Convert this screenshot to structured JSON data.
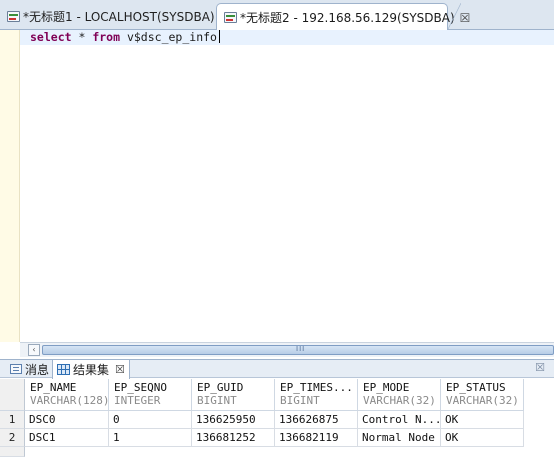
{
  "editor_tabs": [
    {
      "label": "*无标题1 - LOCALHOST(SYSDBA)",
      "active": false
    },
    {
      "label": "*无标题2 - 192.168.56.129(SYSDBA)",
      "active": true,
      "close": "☒"
    }
  ],
  "editor": {
    "kw_select": "select",
    "star": " * ",
    "kw_from": "from",
    "table": " v$dsc_ep_info"
  },
  "scrollbar": {
    "left_arrow": "‹",
    "grip": "III"
  },
  "result_tabs": {
    "messages_label": "消息",
    "results_label": "结果集",
    "close": "☒",
    "maximize": "☒"
  },
  "grid": {
    "columns": [
      {
        "name": "EP_NAME",
        "type": "VARCHAR(128)"
      },
      {
        "name": "EP_SEQNO",
        "type": "INTEGER"
      },
      {
        "name": "EP_GUID",
        "type": "BIGINT"
      },
      {
        "name": "EP_TIMES...",
        "type": "BIGINT"
      },
      {
        "name": "EP_MODE",
        "type": "VARCHAR(32)"
      },
      {
        "name": "EP_STATUS",
        "type": "VARCHAR(32)"
      }
    ],
    "rows": [
      {
        "num": "1",
        "cells": [
          "DSC0",
          "0",
          "136625950",
          "136626875",
          "Control N...",
          "OK"
        ]
      },
      {
        "num": "2",
        "cells": [
          "DSC1",
          "1",
          "136681252",
          "136682119",
          "Normal Node",
          "OK"
        ]
      }
    ]
  }
}
